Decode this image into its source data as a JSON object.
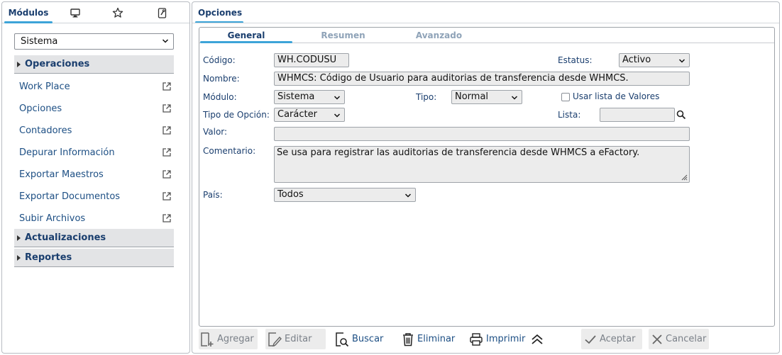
{
  "left": {
    "tabs": [
      {
        "label": "Módulos",
        "icon": "modules-tab"
      },
      {
        "icon": "monitor-icon"
      },
      {
        "icon": "star-icon"
      },
      {
        "icon": "wrench-icon"
      }
    ],
    "system_select": {
      "value": "Sistema"
    },
    "sections": [
      {
        "label": "Operaciones"
      },
      {
        "label": "Actualizaciones"
      },
      {
        "label": "Reportes"
      }
    ],
    "items": [
      {
        "label": "Work Place"
      },
      {
        "label": "Opciones"
      },
      {
        "label": "Contadores"
      },
      {
        "label": "Depurar Información"
      },
      {
        "label": "Exportar Maestros"
      },
      {
        "label": "Exportar Documentos"
      },
      {
        "label": "Subir Archivos"
      }
    ]
  },
  "right": {
    "title": "Opciones",
    "tabs": [
      {
        "label": "General"
      },
      {
        "label": "Resumen"
      },
      {
        "label": "Avanzado"
      }
    ],
    "form": {
      "codigo_label": "Código:",
      "codigo_value": "WH.CODUSU",
      "estatus_label": "Estatus:",
      "estatus_value": "Activo",
      "nombre_label": "Nombre:",
      "nombre_value": "WHMCS: Código de Usuario para auditorias de transferencia desde WHMCS.",
      "modulo_label": "Módulo:",
      "modulo_value": "Sistema",
      "tipo_label": "Tipo:",
      "tipo_value": "Normal",
      "usar_lista_label": "Usar lista de Valores",
      "tipo_opcion_label": "Tipo de Opción:",
      "tipo_opcion_value": "Carácter",
      "lista_label": "Lista:",
      "lista_value": "",
      "valor_label": "Valor:",
      "valor_value": "",
      "comentario_label": "Comentario:",
      "comentario_value": "Se usa para registrar las auditorias de transferencia desde WHMCS a eFactory.",
      "pais_label": "País:",
      "pais_value": "Todos"
    },
    "toolbar": {
      "agregar": "Agregar",
      "editar": "Editar",
      "buscar": "Buscar",
      "eliminar": "Eliminar",
      "imprimir": "Imprimir",
      "aceptar": "Aceptar",
      "cancelar": "Cancelar"
    }
  },
  "colors": {
    "accent": "#3da4d8",
    "label": "#1a3e6e",
    "link": "#1d4f84",
    "field_bg": "#ececec",
    "section_bg": "#e3e4e6"
  }
}
